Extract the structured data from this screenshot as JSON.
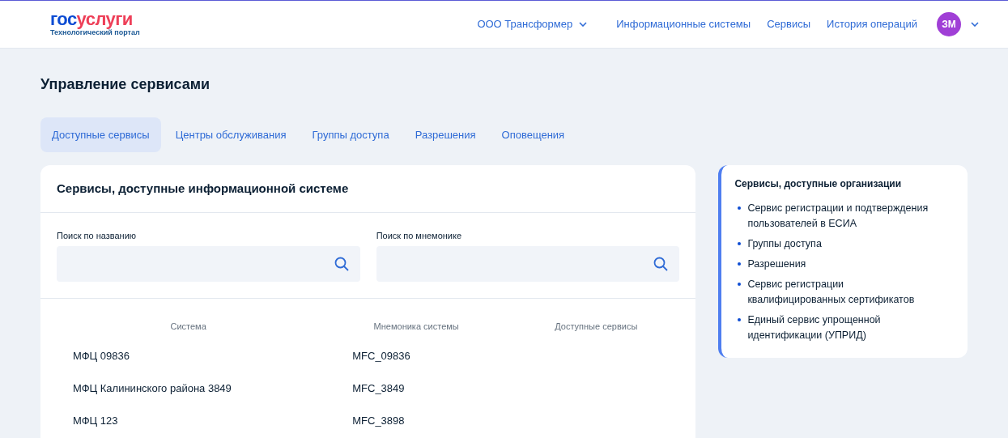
{
  "header": {
    "logo_parts": [
      "гос",
      "услуги"
    ],
    "logo_subtitle": "Технологический портал",
    "organization": "ООО Трансформер",
    "nav": [
      "Информационные системы",
      "Сервисы",
      "История операций"
    ],
    "avatar": "ЗМ"
  },
  "page_title": "Управление сервисами",
  "tabs": [
    {
      "label": "Доступные сервисы",
      "selected": true
    },
    {
      "label": "Центры обслуживания",
      "selected": false
    },
    {
      "label": "Группы доступа",
      "selected": false
    },
    {
      "label": "Разрешения",
      "selected": false
    },
    {
      "label": "Оповещения",
      "selected": false
    }
  ],
  "card": {
    "title": "Сервисы, доступные информационной системе",
    "search_fields": [
      {
        "label": "Поиск по названию"
      },
      {
        "label": "Поиск по мнемонике"
      }
    ],
    "table": {
      "columns": [
        "Система",
        "Мнемоника системы",
        "Доступные сервисы"
      ],
      "rows": [
        [
          "МФЦ 09836",
          "MFC_09836"
        ],
        [
          "МФЦ Калининского района 3849",
          "MFC_3849"
        ],
        [
          "МФЦ 123",
          "MFC_3898"
        ]
      ]
    }
  },
  "info_panel": {
    "title": "Сервисы, доступные организации",
    "items": [
      "Сервис регистрации и подтверждения пользователей в ЕСИА",
      "Группы доступа",
      "Разрешения",
      "Сервис регистрации квалифицированных сертификатов",
      "Единый сервис упрощенной идентификации (УПРИД)"
    ]
  }
}
